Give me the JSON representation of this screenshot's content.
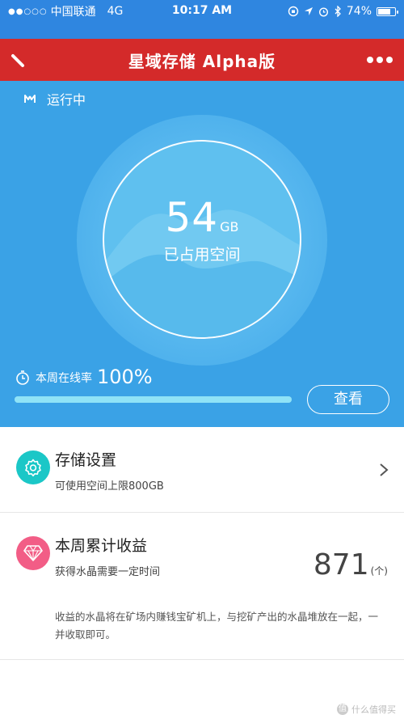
{
  "status_bar": {
    "signal": "●●○○○",
    "carrier": "中国联通",
    "network": "4G",
    "time": "10:17 AM",
    "battery": "74%",
    "battery_level": 0.74
  },
  "header": {
    "title": "星域存储 Alpha版"
  },
  "hero": {
    "status": "运行中",
    "usage_value": "54",
    "usage_unit": "GB",
    "usage_label": "已占用空间",
    "online_label": "本周在线率",
    "online_value": "100%",
    "online_rate": 1.0,
    "view_button": "查看"
  },
  "storage_card": {
    "title": "存储设置",
    "subtitle": "可使用空间上限800GB"
  },
  "earnings_card": {
    "title": "本周累计收益",
    "subtitle": "获得水晶需要一定时间",
    "value": "871",
    "unit": "(个)",
    "description": "收益的水晶将在矿场内赚钱宝矿机上，与挖矿产出的水晶堆放在一起，一并收取即可。"
  },
  "watermark": {
    "text": "什么值得买",
    "badge": "值"
  },
  "colors": {
    "status_blue": "#2f86e0",
    "header_red": "#d42a2a",
    "hero_blue": "#3aa2e6",
    "storage_icon": "#1bc7c7",
    "earnings_icon": "#f25d86"
  },
  "icons": {
    "back": "pencil-icon",
    "more": "more-dots-icon",
    "status": "running-status-icon",
    "timer": "stopwatch-icon",
    "storage": "gear-icon",
    "earnings": "diamond-icon",
    "chevron": "chevron-right-icon"
  }
}
